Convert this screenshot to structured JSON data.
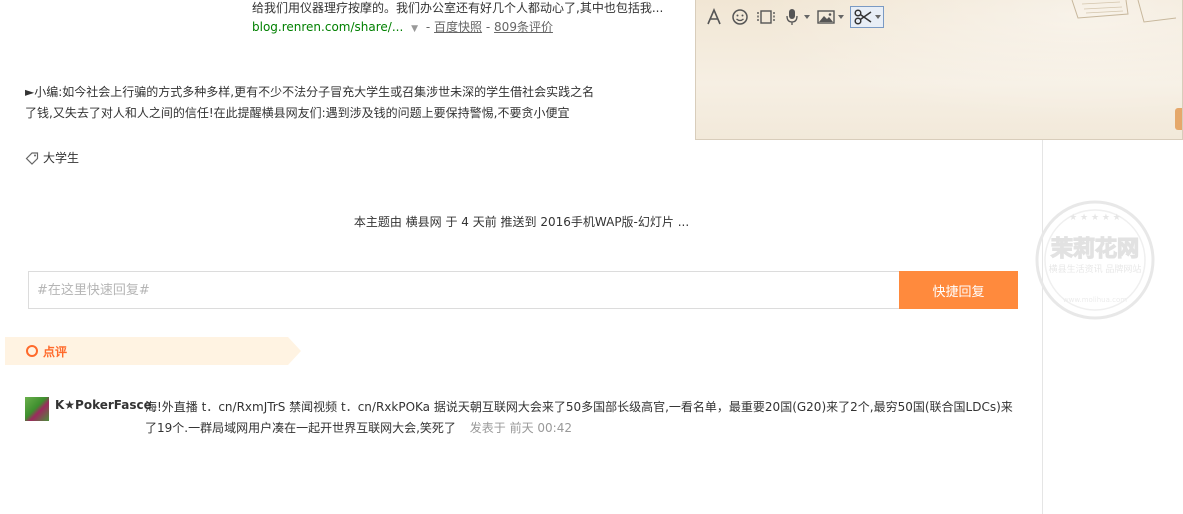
{
  "search_result": {
    "snippet": "给我们用仪器理疗按摩的。我们办公室还有好几个人都动心了,其中也包括我...",
    "url": "blog.renren.com/share/...",
    "separator": "-",
    "cache_link": "百度快照",
    "reviews_link": "809条评价"
  },
  "editor_note": {
    "line1": "►小编:如今社会上行骗的方式多种多样,更有不少不法分子冒充大学生或召集涉世未深的学生借社会实践之名",
    "line2": "了钱,又失去了对人和人之间的信任!在此提醒横县网友们:遇到涉及钱的问题上要保持警惕,不要贪小便宜"
  },
  "tag": {
    "label": "大学生"
  },
  "push_info": "本主题由 横县网 于 4 天前 推送到 2016手机WAP版-幻灯片 ...",
  "quick_reply": {
    "placeholder": "#在这里快速回复#",
    "button_label": "快捷回复"
  },
  "comments_section": {
    "title": "点评"
  },
  "comment": {
    "author": "K★PokerFasce",
    "text": "海!外直播 t．cn/RxmJTrS 禁闻视频 t．cn/RxkPOKa 据说天朝互联网大会来了50多国部长级高官,一看名单，最重要20国(G20)来了2个,最穷50国(联合国LDCs)来了19个.一群局域网用户凑在一起开世界互联网大会,笑死了",
    "posted_label": "发表于",
    "posted_time": "前天 00:42"
  },
  "watermark": {
    "title": "茉莉花网",
    "subtitle": "横县生活资讯 品牌网站",
    "footer": "www.molihua.com"
  },
  "editor_toolbar": {
    "icons": [
      "font-icon",
      "emoji-icon",
      "media-icon",
      "microphone-icon",
      "image-icon",
      "scissors-icon"
    ]
  },
  "colors": {
    "accent": "#ff8a3d",
    "comment_accent": "#ff6a2b",
    "url_green": "#008000",
    "popup_bg": "#f3ebde"
  }
}
